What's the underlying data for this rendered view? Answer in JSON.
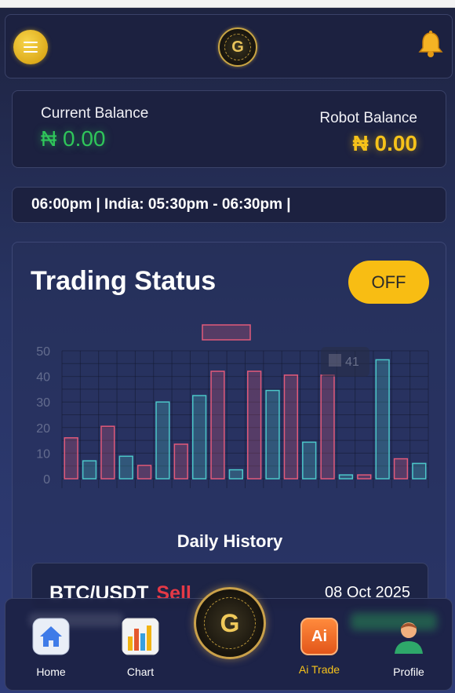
{
  "header": {
    "menu_icon": "hamburger-icon",
    "logo_letter": "G",
    "bell_icon": "bell-icon"
  },
  "balances": {
    "current_label": "Current Balance",
    "current_value": "₦ 0.00",
    "robot_label": "Robot Balance",
    "robot_value": "₦ 0.00"
  },
  "ticker": {
    "text": "06:00pm | India: 05:30pm - 06:30pm |"
  },
  "status": {
    "title": "Trading Status",
    "toggle_label": "OFF",
    "tooltip_value": "41"
  },
  "chart_data": {
    "type": "bar",
    "y_ticks": [
      "50",
      "40",
      "30",
      "20",
      "10",
      "0"
    ],
    "ylim": [
      0,
      50
    ],
    "grid": true,
    "colors": {
      "red": "#e15a7a",
      "teal": "#4cc7c9"
    },
    "bars": [
      {
        "value": 16,
        "color": "red"
      },
      {
        "value": 7,
        "color": "teal"
      },
      {
        "value": 20.5,
        "color": "red"
      },
      {
        "value": 8.8,
        "color": "teal"
      },
      {
        "value": 5.2,
        "color": "red"
      },
      {
        "value": 30,
        "color": "teal"
      },
      {
        "value": 13.5,
        "color": "red"
      },
      {
        "value": 32.5,
        "color": "teal"
      },
      {
        "value": 42,
        "color": "red"
      },
      {
        "value": 3.5,
        "color": "teal"
      },
      {
        "value": 42,
        "color": "red"
      },
      {
        "value": 34.5,
        "color": "teal"
      },
      {
        "value": 40.5,
        "color": "red"
      },
      {
        "value": 14.3,
        "color": "teal"
      },
      {
        "value": 40.5,
        "color": "red"
      },
      {
        "value": 1.5,
        "color": "teal"
      },
      {
        "value": 1.5,
        "color": "red"
      },
      {
        "value": 46.5,
        "color": "teal"
      },
      {
        "value": 7.8,
        "color": "red"
      },
      {
        "value": 6,
        "color": "teal"
      }
    ]
  },
  "history": {
    "heading": "Daily History",
    "pair": "BTC/USDT",
    "side": "Sell",
    "date": "08 Oct 2025"
  },
  "nav": {
    "home": {
      "label": "Home",
      "icon": "home-icon"
    },
    "chart": {
      "label": "Chart",
      "icon": "bar-chart-icon"
    },
    "center": {
      "letter": "G",
      "icon": "coin-logo-icon"
    },
    "ai": {
      "label": "Ai Trade",
      "icon": "ai-icon",
      "badge": "Ai",
      "accent": "#f6c21a"
    },
    "profile": {
      "label": "Profile",
      "icon": "user-icon"
    }
  }
}
